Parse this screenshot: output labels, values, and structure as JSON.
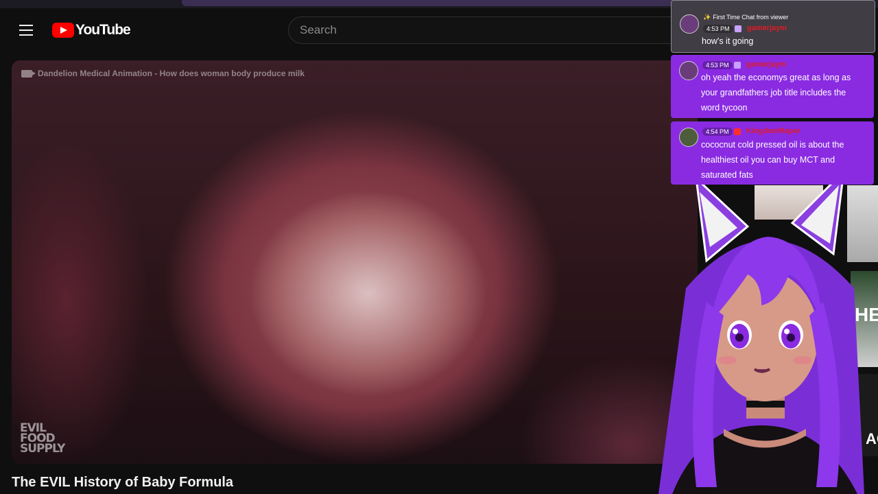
{
  "header": {
    "logo_text": "YouTube",
    "search_placeholder": "Search"
  },
  "video": {
    "watermark": "Dandelion Medical Animation - How does woman body produce milk",
    "channel_logo_lines": [
      "EVIL",
      "FOOD",
      "SUPPLY"
    ],
    "title": "The EVIL History of Baby Formula"
  },
  "thumbnails": {
    "thumb3_text": "HE",
    "thumb4_text": "AC"
  },
  "chat": {
    "messages": [
      {
        "badge": "First Time Chat from viewer",
        "time": "4:53 PM",
        "platform": "twitch",
        "username": "gamerjaym",
        "text": "how's it going"
      },
      {
        "time": "4:53 PM",
        "platform": "twitch",
        "username": "gamerjaym",
        "text": "oh yeah the economys great as long as your grandfathers job title includes the word tycoon"
      },
      {
        "time": "4:54 PM",
        "platform": "youtube",
        "username": "KingdomRaper",
        "text": "cococnut cold pressed oil is about the healthiest oil you can buy MCT and saturated fats"
      }
    ]
  },
  "colors": {
    "chat_purple": "#8a2be2",
    "youtube_red": "#ff0000",
    "username_red": "#e01b24"
  }
}
